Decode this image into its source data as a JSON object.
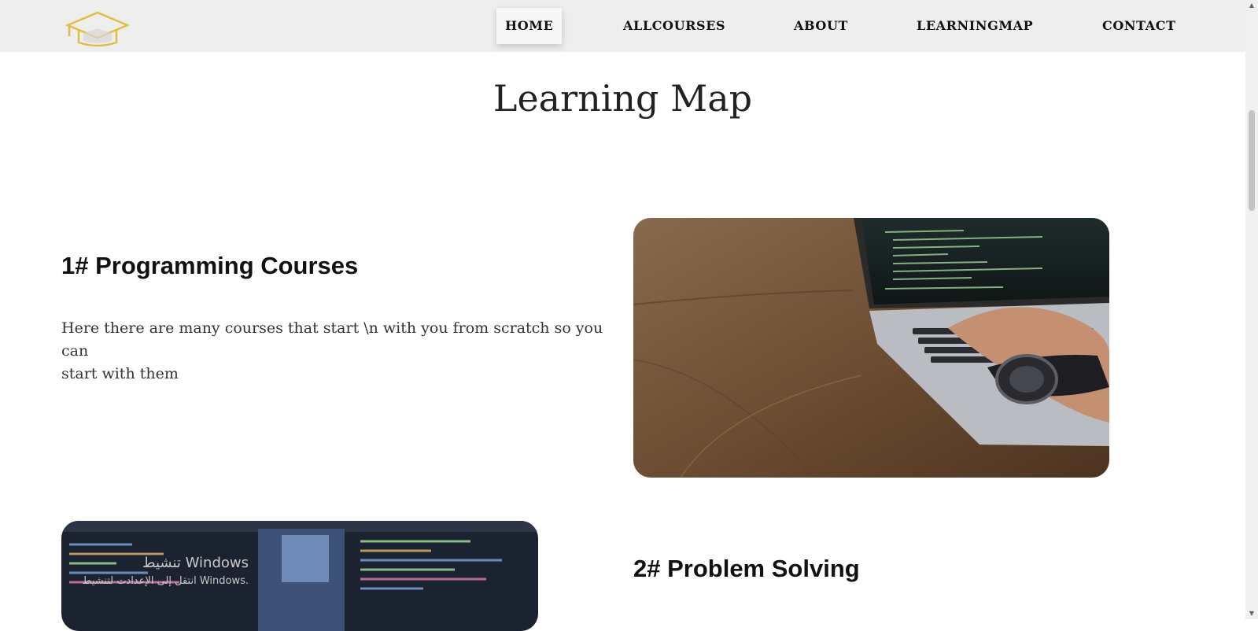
{
  "nav": {
    "items": [
      {
        "label": "HOME",
        "active": true
      },
      {
        "label": "ALLCOURSES",
        "active": false
      },
      {
        "label": "ABOUT",
        "active": false
      },
      {
        "label": "LEARNINGMAP",
        "active": false
      },
      {
        "label": "CONTACT",
        "active": false
      }
    ],
    "logo_icon": "graduation-cap-icon",
    "logo_color": "#e2bd42"
  },
  "page": {
    "title": "Learning Map"
  },
  "sections": [
    {
      "heading": "1# Programming Courses",
      "text_line1": "Here there are many courses that start \\n with you from scratch so you can",
      "text_line2": "start with them",
      "image": "laptop-coding-photo"
    },
    {
      "heading": "2# Problem Solving",
      "image": "code-screen-photo"
    }
  ],
  "overlay": {
    "activation_title": "تنشيط Windows",
    "activation_subtitle": "انتقل إلى الإعدادت لتنشيط Windows."
  }
}
